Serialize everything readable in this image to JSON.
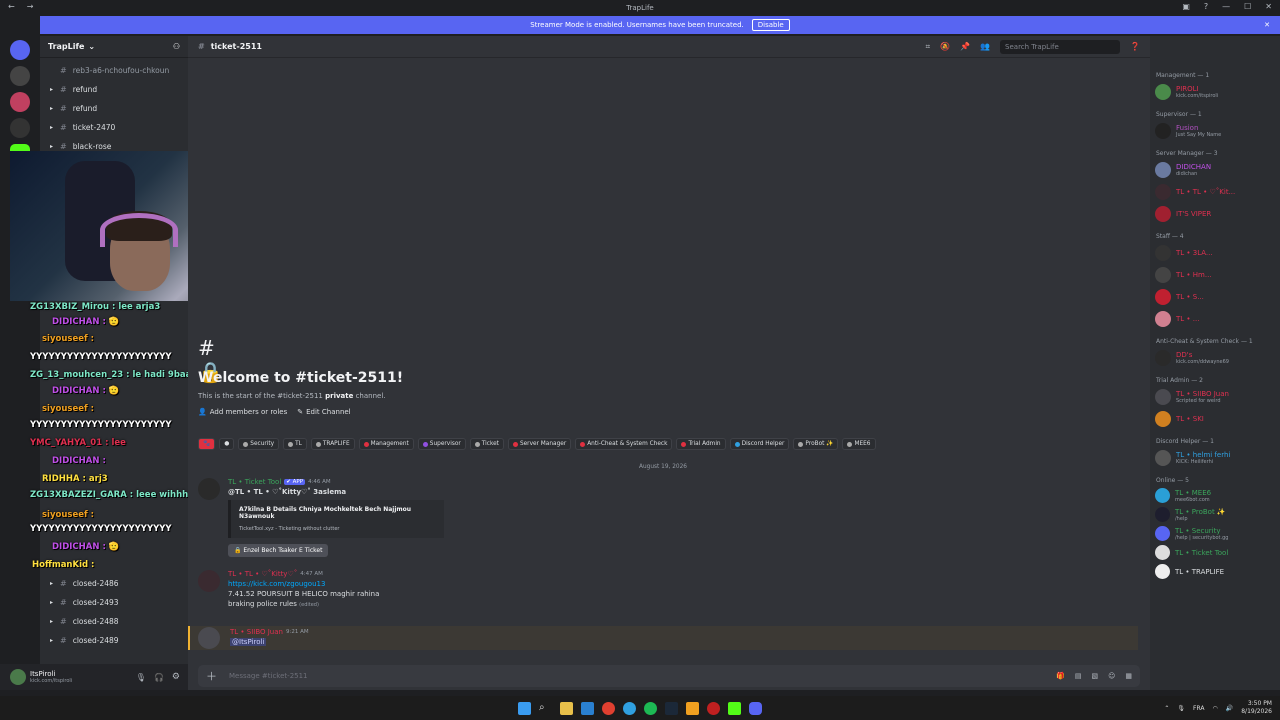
{
  "window": {
    "title": "TrapLife"
  },
  "banner": {
    "text": "Streamer Mode is enabled. Usernames have been truncated.",
    "button": "Disable"
  },
  "server": {
    "name": "TrapLife"
  },
  "channels": [
    {
      "name": "reb3-a6-nchoufou-chkoun"
    },
    {
      "name": "refund"
    },
    {
      "name": "refund"
    },
    {
      "name": "ticket-2470"
    },
    {
      "name": "black-rose"
    }
  ],
  "channels_bottom": [
    {
      "name": "closed-2486"
    },
    {
      "name": "closed-2493"
    },
    {
      "name": "closed-2488"
    },
    {
      "name": "closed-2489"
    }
  ],
  "chat_overlay": [
    {
      "text": "ZG13XBIZ_Mirou : lee arja3",
      "color": "#7ee8c8"
    },
    {
      "text": "DIDICHAN : 🫡",
      "color": "#c050e8"
    },
    {
      "text": "siyouseef :",
      "color": "#f0a020"
    },
    {
      "text": "YYYYYYYYYYYYYYYYYYYYYYY",
      "color": "#ffffff"
    },
    {
      "text": "ZG_13_mouhcen_23 : le hadi 9baal",
      "color": "#7ee8c8"
    },
    {
      "text": "DIDICHAN : 🫡",
      "color": "#c050e8"
    },
    {
      "text": "siyouseef :",
      "color": "#f0a020"
    },
    {
      "text": "YYYYYYYYYYYYYYYYYYYYYYY",
      "color": "#ffffff"
    },
    {
      "text": "YMC_YAHYA_01 : lee",
      "color": "#e03050"
    },
    {
      "text": "DIDICHAN :",
      "color": "#c050e8"
    },
    {
      "text": "RIDHHA : arj3",
      "color": "#ffe040"
    },
    {
      "text": "ZG13XBAZEZI_GARA : leee wihhh le",
      "color": "#7ee8c8"
    },
    {
      "text": "siyouseef :",
      "color": "#f0a020"
    },
    {
      "text": "YYYYYYYYYYYYYYYYYYYYYYY",
      "color": "#ffffff"
    },
    {
      "text": "DIDICHAN : 🫡",
      "color": "#c050e8"
    },
    {
      "text": "HoffmanKid :",
      "color": "#ffe040"
    }
  ],
  "user": {
    "name": "ItsPiroli",
    "status": "kick.com/itspiroli"
  },
  "main": {
    "channel": "ticket-2511",
    "search_placeholder": "Search TrapLife",
    "welcome_title": "Welcome to #ticket-2511!",
    "welcome_sub_a": "This is the start of the #ticket-2511 ",
    "welcome_sub_b": "private",
    "welcome_sub_c": " channel.",
    "add_members": "Add members or roles",
    "edit_channel": "Edit Channel",
    "date_divider": "August 19, 2026",
    "composer_placeholder": "Message #ticket-2511"
  },
  "roles": [
    {
      "name": "Security",
      "color": "#aaaaaa"
    },
    {
      "name": "TL",
      "color": "#aaaaaa"
    },
    {
      "name": "TRAPLIFE",
      "color": "#aaaaaa"
    },
    {
      "name": "Management",
      "color": "#e03040"
    },
    {
      "name": "Supervisor",
      "color": "#9050e0"
    },
    {
      "name": "Ticket",
      "color": "#aaaaaa"
    },
    {
      "name": "Server Manager",
      "color": "#e03040"
    },
    {
      "name": "Anti-Cheat & System Check",
      "color": "#e03040"
    },
    {
      "name": "Trial Admin",
      "color": "#e03040"
    },
    {
      "name": "Discord Helper",
      "color": "#30a0e0"
    },
    {
      "name": "ProBot ✨",
      "color": "#aaaaaa"
    },
    {
      "name": "MEE6",
      "color": "#aaaaaa"
    }
  ],
  "messages": [
    {
      "author": "TL • Ticket Tool",
      "author_color": "#3ba55c",
      "tag": "✔ APP",
      "time": "4:46 AM",
      "text": "@TL • TL • ♡˚Kitty♡˚ 3aslema",
      "embed_title": "A7kilna B Details Chniya Mochkeltek Bech Najjmou N3awnouk",
      "embed_footer": "TicketTool.xyz - Ticketing without clutter",
      "button": "🔒 Enzel Bech Tsaker E Ticket"
    },
    {
      "author": "TL • TL • ♡˚Kitty♡˚",
      "author_color": "#e03050",
      "time": "4:47 AM",
      "link": "https://kick.com/zgougou13",
      "text": "7.41.52 POURSUIT B HELICO maghir rahina",
      "text2": "braking police rules",
      "edited": "(edited)"
    },
    {
      "author": "TL • SIIBO Juan",
      "author_color": "#e03050",
      "time": "9:21 AM",
      "text": "@ItsPiroli"
    }
  ],
  "member_groups": [
    {
      "title": "Management — 1",
      "members": [
        {
          "name": "PIROLI",
          "status": "kick.com/itspiroli",
          "color": "#e03050"
        }
      ]
    },
    {
      "title": "Supervisor — 1",
      "members": [
        {
          "name": "Fusion",
          "status": "Just Say My Name",
          "color": "#b050c0"
        }
      ]
    },
    {
      "title": "Server Manager — 3",
      "members": [
        {
          "name": "DIDICHAN",
          "status": "didichan",
          "color": "#c050e8"
        },
        {
          "name": "TL • TL • ♡˚Kit...",
          "status": "",
          "color": "#e03050"
        },
        {
          "name": "IT'S VIPER",
          "status": "",
          "color": "#e03050"
        }
      ]
    },
    {
      "title": "Staff — 4",
      "members": [
        {
          "name": "TL • 3LA...",
          "status": "",
          "color": "#e03050"
        },
        {
          "name": "TL • Hm...",
          "status": "",
          "color": "#e03050"
        },
        {
          "name": "TL • S...",
          "status": "",
          "color": "#e03050"
        },
        {
          "name": "TL • ...",
          "status": "",
          "color": "#e03050"
        }
      ]
    },
    {
      "title": "Anti-Cheat & System Check — 1",
      "members": [
        {
          "name": "DD's",
          "status": "kick.com/ddwayne69",
          "color": "#e03050"
        }
      ]
    },
    {
      "title": "Trial Admin — 2",
      "members": [
        {
          "name": "TL • SIIBO Juan",
          "status": "Scripted for weird",
          "color": "#e03050"
        },
        {
          "name": "TL • SKI",
          "status": "",
          "color": "#e03050"
        }
      ]
    },
    {
      "title": "Discord Helper — 1",
      "members": [
        {
          "name": "TL • helmi ferhi",
          "status": "KICK: Heiliferhi",
          "color": "#30a0e0"
        }
      ]
    },
    {
      "title": "Online — 5",
      "members": [
        {
          "name": "TL • MEE6",
          "status": "mee6bot.com",
          "color": "#3ba55c"
        },
        {
          "name": "TL • ProBot ✨",
          "status": "/help",
          "color": "#3ba55c"
        },
        {
          "name": "TL • Security",
          "status": "/help | securitybot.gg",
          "color": "#3ba55c"
        },
        {
          "name": "TL • Ticket Tool",
          "status": "",
          "color": "#3ba55c"
        },
        {
          "name": "TL • TRAPLIFE",
          "status": "",
          "color": "#dbdee1"
        }
      ]
    }
  ],
  "taskbar": {
    "lang": "FRA",
    "time": "3:50 PM",
    "date": "8/19/2026"
  }
}
